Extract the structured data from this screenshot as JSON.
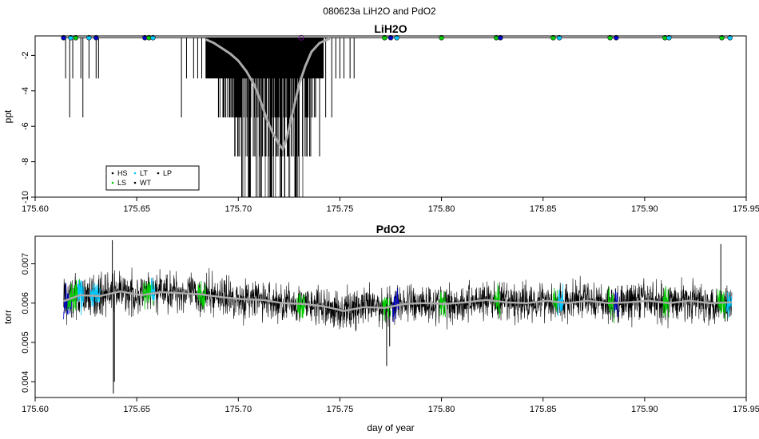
{
  "figure_title": "080623a   LiH2O and PdO2",
  "chart_data": [
    {
      "type": "line",
      "title": "LiH2O",
      "xlabel": "",
      "ylabel": "ppt",
      "xlim": [
        175.6,
        175.95
      ],
      "ylim": [
        -10,
        -0.9
      ],
      "x_ticks": [
        "175.60",
        "175.65",
        "175.70",
        "175.75",
        "175.80",
        "175.85",
        "175.90",
        "175.95"
      ],
      "y_ticks": [
        "-2",
        "-4",
        "-6",
        "-8",
        "-10"
      ],
      "y_tick_values": [
        -2,
        -4,
        -6,
        -8,
        -10
      ],
      "grid": false,
      "baseline": -1.0,
      "legend": {
        "placement": "bottom-left",
        "entries": [
          {
            "label": "HS",
            "color": "#000000"
          },
          {
            "label": "LT",
            "color": "#00c8ff"
          },
          {
            "label": "LP",
            "color": "#000000"
          },
          {
            "label": "LS",
            "color": "#00cc00"
          },
          {
            "label": "WT",
            "color": "#000000"
          }
        ]
      },
      "series": [
        {
          "color": "#000000",
          "spikes": [
            {
              "x": 175.615,
              "y": -3.3
            },
            {
              "x": 175.617,
              "y": -5.5
            },
            {
              "x": 175.6185,
              "y": -3.3
            },
            {
              "x": 175.6225,
              "y": -3.3
            },
            {
              "x": 175.6235,
              "y": -5.5
            },
            {
              "x": 175.6265,
              "y": -3.3
            },
            {
              "x": 175.63,
              "y": -3.3
            },
            {
              "x": 175.6312,
              "y": -3.3
            },
            {
              "x": 175.672,
              "y": -5.5
            },
            {
              "x": 175.6745,
              "y": -3.3
            },
            {
              "x": 175.678,
              "y": -3.3
            },
            {
              "x": 175.68,
              "y": -3.3
            },
            {
              "x": 175.682,
              "y": -3.3
            },
            {
              "x": 175.686,
              "y": -3.3
            },
            {
              "x": 175.731,
              "y": -3.3
            },
            {
              "x": 175.733,
              "y": -5.5
            },
            {
              "x": 175.736,
              "y": -3.3
            },
            {
              "x": 175.74,
              "y": -7.7
            },
            {
              "x": 175.743,
              "y": -5.5
            },
            {
              "x": 175.746,
              "y": -5.5
            },
            {
              "x": 175.748,
              "y": -3.3
            },
            {
              "x": 175.75,
              "y": -3.3
            },
            {
              "x": 175.752,
              "y": -3.3
            },
            {
              "x": 175.755,
              "y": -3.3
            },
            {
              "x": 175.757,
              "y": -3.3
            }
          ],
          "dense_band": {
            "x_start": 175.684,
            "x_end": 175.742,
            "min_envelope": [
              {
                "x": 175.684,
                "y": -3.3
              },
              {
                "x": 175.69,
                "y": -5.5
              },
              {
                "x": 175.696,
                "y": -7.7
              },
              {
                "x": 175.7,
                "y": -10.0
              },
              {
                "x": 175.732,
                "y": -10.0
              },
              {
                "x": 175.736,
                "y": -7.7
              },
              {
                "x": 175.74,
                "y": -5.5
              },
              {
                "x": 175.742,
                "y": -3.3
              }
            ]
          }
        },
        {
          "color": "#aaaaaa",
          "smooth": [
            {
              "x": 175.684,
              "y": -1.1
            },
            {
              "x": 175.688,
              "y": -1.3
            },
            {
              "x": 175.692,
              "y": -1.6
            },
            {
              "x": 175.696,
              "y": -1.9
            },
            {
              "x": 175.7,
              "y": -2.3
            },
            {
              "x": 175.704,
              "y": -2.9
            },
            {
              "x": 175.708,
              "y": -3.7
            },
            {
              "x": 175.711,
              "y": -4.6
            },
            {
              "x": 175.714,
              "y": -5.6
            },
            {
              "x": 175.717,
              "y": -6.4
            },
            {
              "x": 175.72,
              "y": -7.0
            },
            {
              "x": 175.722,
              "y": -7.3
            },
            {
              "x": 175.724,
              "y": -6.6
            },
            {
              "x": 175.726,
              "y": -5.6
            },
            {
              "x": 175.728,
              "y": -4.6
            },
            {
              "x": 175.73,
              "y": -3.6
            },
            {
              "x": 175.733,
              "y": -2.6
            },
            {
              "x": 175.736,
              "y": -1.8
            },
            {
              "x": 175.74,
              "y": -1.3
            },
            {
              "x": 175.745,
              "y": -1.05
            }
          ]
        }
      ],
      "markers": [
        {
          "x": 175.614,
          "color": "#0000cc"
        },
        {
          "x": 175.6175,
          "color": "#00c8ff"
        },
        {
          "x": 175.62,
          "color": "#00cc00"
        },
        {
          "x": 175.6265,
          "color": "#00c8ff"
        },
        {
          "x": 175.63,
          "color": "#0000cc"
        },
        {
          "x": 175.654,
          "color": "#0000cc"
        },
        {
          "x": 175.656,
          "color": "#00cc00"
        },
        {
          "x": 175.658,
          "color": "#00c8ff"
        },
        {
          "x": 175.731,
          "color": "#9900cc"
        },
        {
          "x": 175.772,
          "color": "#00cc00"
        },
        {
          "x": 175.775,
          "color": "#0000cc"
        },
        {
          "x": 175.778,
          "color": "#00c8ff"
        },
        {
          "x": 175.8,
          "color": "#00cc00"
        },
        {
          "x": 175.827,
          "color": "#00cc00"
        },
        {
          "x": 175.829,
          "color": "#0000cc"
        },
        {
          "x": 175.855,
          "color": "#00cc00"
        },
        {
          "x": 175.858,
          "color": "#00c8ff"
        },
        {
          "x": 175.883,
          "color": "#00cc00"
        },
        {
          "x": 175.886,
          "color": "#0000cc"
        },
        {
          "x": 175.91,
          "color": "#00cc00"
        },
        {
          "x": 175.912,
          "color": "#00c8ff"
        },
        {
          "x": 175.938,
          "color": "#00cc00"
        },
        {
          "x": 175.942,
          "color": "#00c8ff"
        }
      ]
    },
    {
      "type": "line",
      "title": "PdO2",
      "xlabel": "day of year",
      "ylabel": "torr",
      "xlim": [
        175.6,
        175.95
      ],
      "ylim": [
        0.0036,
        0.0077
      ],
      "x_ticks": [
        "175.60",
        "175.65",
        "175.70",
        "175.75",
        "175.80",
        "175.85",
        "175.90",
        "175.95"
      ],
      "y_ticks": [
        "0.004",
        "0.005",
        "0.006",
        "0.007"
      ],
      "y_tick_values": [
        0.004,
        0.005,
        0.006,
        0.007
      ],
      "grid": false,
      "series": [
        {
          "color": "#000000",
          "noise_sd": 0.00035,
          "trend": [
            {
              "x": 175.614,
              "y": 0.006
            },
            {
              "x": 175.62,
              "y": 0.0062
            },
            {
              "x": 175.63,
              "y": 0.0062
            },
            {
              "x": 175.64,
              "y": 0.0063
            },
            {
              "x": 175.65,
              "y": 0.0062
            },
            {
              "x": 175.66,
              "y": 0.0063
            },
            {
              "x": 175.67,
              "y": 0.0063
            },
            {
              "x": 175.68,
              "y": 0.0062
            },
            {
              "x": 175.69,
              "y": 0.0062
            },
            {
              "x": 175.7,
              "y": 0.0061
            },
            {
              "x": 175.71,
              "y": 0.0061
            },
            {
              "x": 175.72,
              "y": 0.006
            },
            {
              "x": 175.73,
              "y": 0.006
            },
            {
              "x": 175.74,
              "y": 0.0059
            },
            {
              "x": 175.75,
              "y": 0.0058
            },
            {
              "x": 175.76,
              "y": 0.0059
            },
            {
              "x": 175.77,
              "y": 0.0059
            },
            {
              "x": 175.78,
              "y": 0.006
            },
            {
              "x": 175.79,
              "y": 0.006
            },
            {
              "x": 175.8,
              "y": 0.006
            },
            {
              "x": 175.81,
              "y": 0.006
            },
            {
              "x": 175.82,
              "y": 0.0061
            },
            {
              "x": 175.83,
              "y": 0.006
            },
            {
              "x": 175.84,
              "y": 0.006
            },
            {
              "x": 175.85,
              "y": 0.0061
            },
            {
              "x": 175.86,
              "y": 0.006
            },
            {
              "x": 175.87,
              "y": 0.0061
            },
            {
              "x": 175.88,
              "y": 0.006
            },
            {
              "x": 175.89,
              "y": 0.006
            },
            {
              "x": 175.9,
              "y": 0.0061
            },
            {
              "x": 175.91,
              "y": 0.006
            },
            {
              "x": 175.92,
              "y": 0.0061
            },
            {
              "x": 175.93,
              "y": 0.006
            },
            {
              "x": 175.943,
              "y": 0.006
            }
          ],
          "outliers": [
            {
              "x": 175.638,
              "y": 0.0076
            },
            {
              "x": 175.6385,
              "y": 0.0037
            },
            {
              "x": 175.639,
              "y": 0.004
            },
            {
              "x": 175.773,
              "y": 0.0044
            },
            {
              "x": 175.7745,
              "y": 0.0049
            },
            {
              "x": 175.9375,
              "y": 0.0075
            }
          ]
        },
        {
          "color": "#aaaaaa",
          "smooth": [
            {
              "x": 175.614,
              "y": 0.00605
            },
            {
              "x": 175.622,
              "y": 0.0062
            },
            {
              "x": 175.632,
              "y": 0.00618
            },
            {
              "x": 175.642,
              "y": 0.0063
            },
            {
              "x": 175.652,
              "y": 0.0062
            },
            {
              "x": 175.662,
              "y": 0.00628
            },
            {
              "x": 175.672,
              "y": 0.00625
            },
            {
              "x": 175.682,
              "y": 0.00622
            },
            {
              "x": 175.692,
              "y": 0.00615
            },
            {
              "x": 175.702,
              "y": 0.0061
            },
            {
              "x": 175.712,
              "y": 0.00608
            },
            {
              "x": 175.722,
              "y": 0.006
            },
            {
              "x": 175.732,
              "y": 0.00598
            },
            {
              "x": 175.742,
              "y": 0.00592
            },
            {
              "x": 175.752,
              "y": 0.0058
            },
            {
              "x": 175.762,
              "y": 0.0059
            },
            {
              "x": 175.772,
              "y": 0.00588
            },
            {
              "x": 175.782,
              "y": 0.00598
            },
            {
              "x": 175.792,
              "y": 0.006
            },
            {
              "x": 175.802,
              "y": 0.00598
            },
            {
              "x": 175.812,
              "y": 0.00602
            },
            {
              "x": 175.822,
              "y": 0.00608
            },
            {
              "x": 175.832,
              "y": 0.00602
            },
            {
              "x": 175.842,
              "y": 0.006
            },
            {
              "x": 175.852,
              "y": 0.00606
            },
            {
              "x": 175.862,
              "y": 0.006
            },
            {
              "x": 175.872,
              "y": 0.00606
            },
            {
              "x": 175.882,
              "y": 0.006
            },
            {
              "x": 175.892,
              "y": 0.00602
            },
            {
              "x": 175.902,
              "y": 0.00606
            },
            {
              "x": 175.912,
              "y": 0.006
            },
            {
              "x": 175.922,
              "y": 0.00606
            },
            {
              "x": 175.932,
              "y": 0.006
            },
            {
              "x": 175.943,
              "y": 0.00602
            }
          ]
        }
      ],
      "colored_segments": [
        {
          "x_start": 175.614,
          "x_end": 175.618,
          "color": "#0000cc"
        },
        {
          "x_start": 175.616,
          "x_end": 175.622,
          "color": "#00cc00"
        },
        {
          "x_start": 175.621,
          "x_end": 175.624,
          "color": "#00c8ff"
        },
        {
          "x_start": 175.627,
          "x_end": 175.632,
          "color": "#00c8ff"
        },
        {
          "x_start": 175.653,
          "x_end": 175.658,
          "color": "#00cc00"
        },
        {
          "x_start": 175.657,
          "x_end": 175.659,
          "color": "#00c8ff"
        },
        {
          "x_start": 175.68,
          "x_end": 175.684,
          "color": "#00cc00"
        },
        {
          "x_start": 175.729,
          "x_end": 175.733,
          "color": "#00cc00"
        },
        {
          "x_start": 175.771,
          "x_end": 175.775,
          "color": "#00cc00"
        },
        {
          "x_start": 175.776,
          "x_end": 175.779,
          "color": "#0000cc"
        },
        {
          "x_start": 175.799,
          "x_end": 175.802,
          "color": "#00cc00"
        },
        {
          "x_start": 175.826,
          "x_end": 175.829,
          "color": "#00cc00"
        },
        {
          "x_start": 175.855,
          "x_end": 175.857,
          "color": "#00cc00"
        },
        {
          "x_start": 175.857,
          "x_end": 175.86,
          "color": "#00c8ff"
        },
        {
          "x_start": 175.882,
          "x_end": 175.885,
          "color": "#00cc00"
        },
        {
          "x_start": 175.885,
          "x_end": 175.887,
          "color": "#0000cc"
        },
        {
          "x_start": 175.909,
          "x_end": 175.912,
          "color": "#00cc00"
        },
        {
          "x_start": 175.936,
          "x_end": 175.94,
          "color": "#00cc00"
        },
        {
          "x_start": 175.94,
          "x_end": 175.943,
          "color": "#00c8ff"
        }
      ]
    }
  ]
}
